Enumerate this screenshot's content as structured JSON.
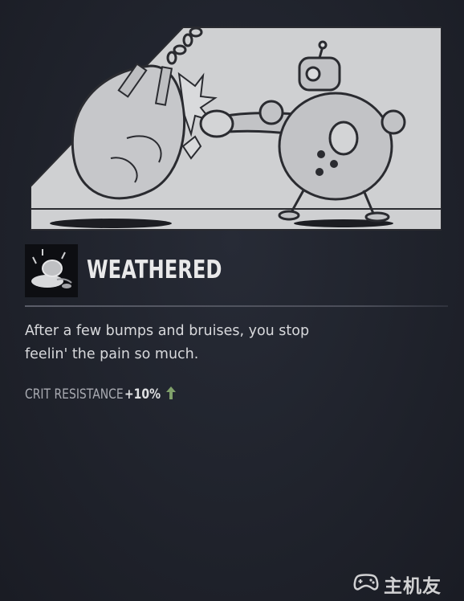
{
  "ability": {
    "title": "WEATHERED",
    "description_lines": [
      "After a few bumps and bruises, you stop",
      "feelin' the pain so much."
    ],
    "stat": {
      "label": "CRIT RESISTANCE",
      "value": "+10%",
      "trend_icon": "arrow-up-icon"
    }
  },
  "watermark": {
    "logo_icon": "gamepad-icon",
    "text": "主机友"
  },
  "colors": {
    "background": "#20232d",
    "art_panel": "#cfd0d2",
    "title": "#e9e9ea",
    "stat_label": "#a9abb2",
    "arrow_green": "#7fa06a"
  }
}
